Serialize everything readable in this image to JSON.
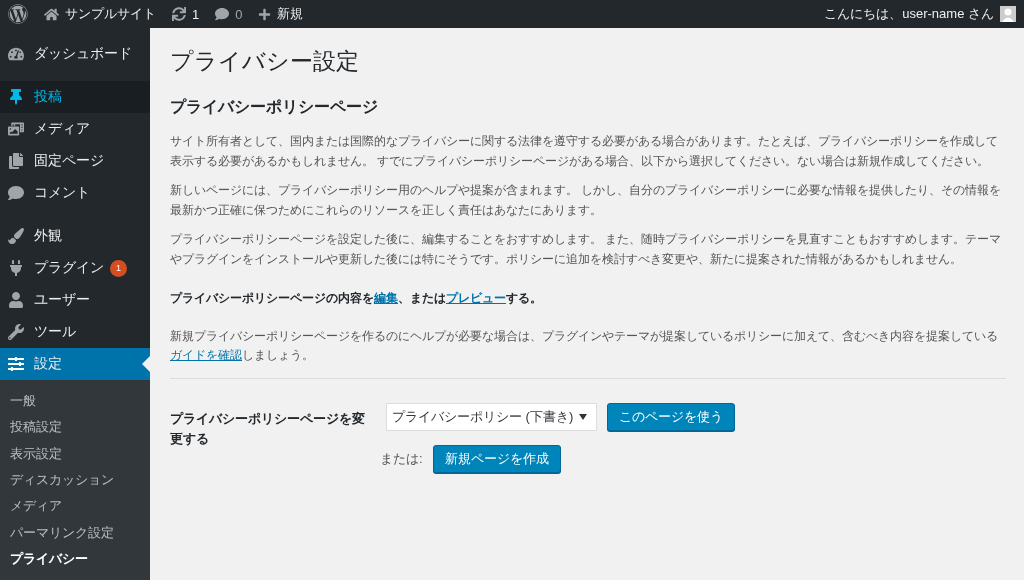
{
  "admin_bar": {
    "site_name": "サンプルサイト",
    "updates": "1",
    "comments": "0",
    "new": "新規",
    "greeting": "こんにちは、user-name さん"
  },
  "sidebar": {
    "items": [
      {
        "kind": "dashboard",
        "label": "ダッシュボード",
        "selected": false,
        "hovered": false,
        "gap_before": false
      },
      {
        "kind": "posts",
        "label": "投稿",
        "selected": false,
        "hovered": true,
        "gap_before": true
      },
      {
        "kind": "media",
        "label": "メディア",
        "selected": false,
        "hovered": false,
        "gap_before": false
      },
      {
        "kind": "pages",
        "label": "固定ページ",
        "selected": false,
        "hovered": false,
        "gap_before": false
      },
      {
        "kind": "comments",
        "label": "コメント",
        "selected": false,
        "hovered": false,
        "gap_before": false
      },
      {
        "kind": "appearance",
        "label": "外観",
        "selected": false,
        "hovered": false,
        "gap_before": true
      },
      {
        "kind": "plugins",
        "label": "プラグイン",
        "badge": "1",
        "selected": false,
        "hovered": false,
        "gap_before": false
      },
      {
        "kind": "users",
        "label": "ユーザー",
        "selected": false,
        "hovered": false,
        "gap_before": false
      },
      {
        "kind": "tools",
        "label": "ツール",
        "selected": false,
        "hovered": false,
        "gap_before": false
      },
      {
        "kind": "settings",
        "label": "設定",
        "selected": true,
        "hovered": false,
        "gap_before": false
      }
    ],
    "submenu": [
      {
        "label": "一般",
        "selected": false
      },
      {
        "label": "投稿設定",
        "selected": false
      },
      {
        "label": "表示設定",
        "selected": false
      },
      {
        "label": "ディスカッション",
        "selected": false
      },
      {
        "label": "メディア",
        "selected": false
      },
      {
        "label": "パーマリンク設定",
        "selected": false
      },
      {
        "label": "プライバシー",
        "selected": true
      }
    ]
  },
  "page": {
    "title": "プライバシー設定",
    "section_title": "プライバシーポリシーページ",
    "paragraphs": [
      {
        "bold": false,
        "parts": [
          {
            "kind": "text",
            "text": "サイト所有者として、国内または国際的なプライバシーに関する法律を遵守する必要がある場合があります。たとえば、プライバシーポリシーを作成して表示する必要があるかもしれません。 すでにプライバシーポリシーページがある場合、以下から選択してください。ない場合は新規作成してください。"
          }
        ]
      },
      {
        "bold": false,
        "parts": [
          {
            "kind": "text",
            "text": "新しいページには、プライバシーポリシー用のヘルプや提案が含まれます。 しかし、自分のプライバシーポリシーに必要な情報を提供したり、その情報を最新かつ正確に保つためにこれらのリソースを正しく責任はあなたにあります。"
          }
        ]
      },
      {
        "bold": false,
        "parts": [
          {
            "kind": "text",
            "text": "プライバシーポリシーページを設定した後に、編集することをおすすめします。 また、随時プライバシーポリシーを見直すこともおすすめします。テーマやプラグインをインストールや更新した後には特にそうです。ポリシーに追加を検討すべき変更や、新たに提案された情報があるかもしれません。"
          }
        ]
      },
      {
        "bold": true,
        "parts": [
          {
            "kind": "text",
            "text": "プライバシーポリシーページの内容を"
          },
          {
            "kind": "link",
            "text": "編集"
          },
          {
            "kind": "text",
            "text": "、または"
          },
          {
            "kind": "link",
            "text": "プレビュー"
          },
          {
            "kind": "text",
            "text": "する。"
          }
        ]
      },
      {
        "bold": false,
        "parts": [
          {
            "kind": "text",
            "text": "新規プライバシーポリシーページを作るのにヘルプが必要な場合は、プラグインやテーマが提案しているポリシーに加えて、含むべき内容を提案している"
          },
          {
            "kind": "link",
            "text": "ガイドを確認"
          },
          {
            "kind": "text",
            "text": "しましょう。"
          }
        ]
      }
    ],
    "form": {
      "label": "プライバシーポリシーページを変更する",
      "select_value": "プライバシーポリシー (下書き)",
      "use_button": "このページを使う",
      "or_label": "または:",
      "create_button": "新規ページを作成"
    }
  }
}
